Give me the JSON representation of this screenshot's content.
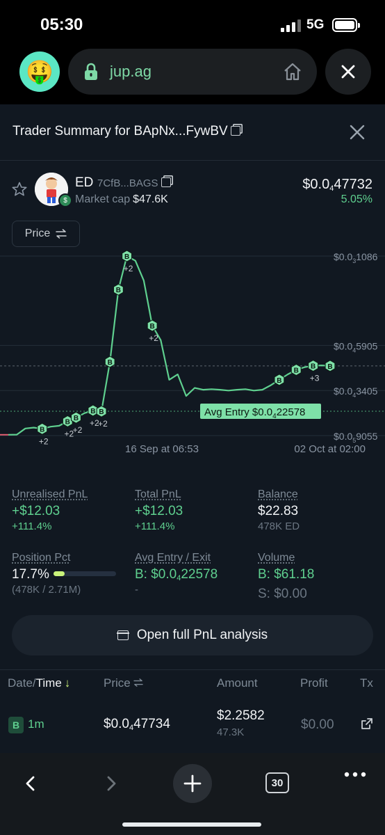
{
  "status_bar": {
    "time": "05:30",
    "network": "5G"
  },
  "browser": {
    "url": "jup.ag",
    "avatar_emoji": "🤑"
  },
  "sheet": {
    "title": "Trader Summary for BApNx...FywBV"
  },
  "token": {
    "symbol": "ED",
    "address": "7CfB...BAGS",
    "market_cap_label": "Market cap",
    "market_cap": "$47.6K",
    "price_prefix": "$0.0",
    "price_sub": "4",
    "price_rest": "47732",
    "change": "5.05%"
  },
  "chart_toggle": {
    "label": "Price"
  },
  "chart_data": {
    "type": "line",
    "y_ticks": [
      {
        "prefix": "$0.0",
        "sub": "3",
        "rest": "1086",
        "value": 0.0001086
      },
      {
        "prefix": "$0.0",
        "sub": "4",
        "rest": "5905",
        "value": 5.905e-05
      },
      {
        "prefix": "$0.0",
        "sub": "4",
        "rest": "3405",
        "value": 3.405e-05
      },
      {
        "prefix": "$0.0",
        "sub": "4",
        "rest": "0",
        "value": 9.055e-06
      }
    ],
    "y_tick_last_label": "$0.0",
    "y_tick_last_sub": "5",
    "y_tick_last_rest": "9055",
    "x_ticks": [
      "16 Sep at 06:53",
      "02 Oct at 02:00"
    ],
    "avg_entry_label": "Avg Entry ",
    "avg_entry_prefix": "$0.0",
    "avg_entry_sub": "4",
    "avg_entry_rest": "22578",
    "avg_entry_value": 2.2578e-05,
    "current_price_value": 4.77e-05,
    "ylim": [
      9.055e-06,
      0.0001086
    ],
    "series": [
      {
        "values": [
          9.5e-06,
          9.6e-06,
          1.3e-05,
          1.35e-05,
          1.28e-05,
          1.4e-05,
          1.45e-05,
          1.7e-05,
          1.9e-05,
          2.15e-05,
          2.3e-05,
          2.25e-05,
          5e-05,
          9e-05,
          0.0001086,
          0.000106,
          9.5e-05,
          7e-05,
          6.2e-05,
          4e-05,
          4.3e-05,
          3.1e-05,
          3.55e-05,
          3.45e-05,
          3.48e-05,
          3.45e-05,
          3.4e-05,
          3.45e-05,
          3.48e-05,
          3.4e-05,
          3.45e-05,
          3.7e-05,
          4e-05,
          4.3e-05,
          4.55e-05,
          4.7e-05,
          4.78e-05,
          4.8e-05,
          4.77e-05
        ]
      }
    ],
    "buy_markers": [
      {
        "i": 4,
        "label": "+2"
      },
      {
        "i": 7,
        "label": "+2"
      },
      {
        "i": 8,
        "label": "+2"
      },
      {
        "i": 10,
        "label": "+2"
      },
      {
        "i": 11,
        "label": "+2"
      },
      {
        "i": 12,
        "label": ""
      },
      {
        "i": 13,
        "label": ""
      },
      {
        "i": 14,
        "label": "+2"
      },
      {
        "i": 17,
        "label": "+2"
      },
      {
        "i": 32,
        "label": ""
      },
      {
        "i": 34,
        "label": ""
      },
      {
        "i": 36,
        "label": "+3"
      },
      {
        "i": 38,
        "label": ""
      }
    ],
    "marker_letter": "B"
  },
  "stats": {
    "unrealised": {
      "label": "Unrealised PnL",
      "value": "+$12.03",
      "pct": "+111.4%"
    },
    "total": {
      "label": "Total PnL",
      "value": "+$12.03",
      "pct": "+111.4%"
    },
    "balance": {
      "label": "Balance",
      "value": "$22.83",
      "sub": "478K ED"
    },
    "position": {
      "label": "Position Pct",
      "value": "17.7%",
      "sub": "(478K / 2.71M)",
      "fill": 0.177
    },
    "avg_entry_exit": {
      "label": "Avg Entry / Exit",
      "buy_prefix": "B: $0.0",
      "buy_sub": "4",
      "buy_rest": "22578",
      "exit": "-"
    },
    "volume": {
      "label": "Volume",
      "buy": "B: $61.18",
      "sell": "S: $0.00"
    }
  },
  "pnl_button": {
    "label": "Open full PnL analysis"
  },
  "table": {
    "headers": {
      "date": "Date/",
      "time": "Time",
      "price": "Price",
      "amount": "Amount",
      "profit": "Profit",
      "tx": "Tx"
    },
    "rows": [
      {
        "side": "B",
        "time": "1m",
        "price_prefix": "$0.0",
        "price_sub": "4",
        "price_rest": "47734",
        "amount": "$2.2582",
        "qty": "47.3K",
        "profit": "$0.00"
      }
    ]
  },
  "toolbar": {
    "tabs_count": "30"
  },
  "colors": {
    "accent": "#5fd08f",
    "panel": "#111821",
    "marker": "#7ee0a8"
  }
}
